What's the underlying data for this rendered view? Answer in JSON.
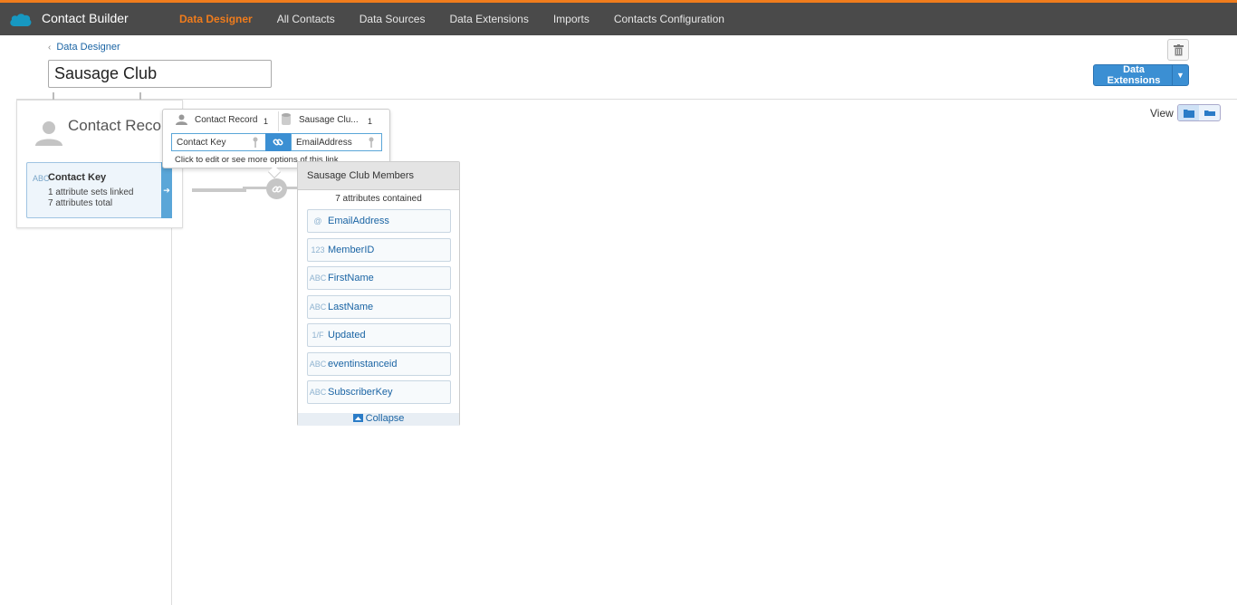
{
  "app": {
    "title": "Contact Builder"
  },
  "nav": [
    {
      "label": "Data Designer",
      "active": true
    },
    {
      "label": "All Contacts",
      "active": false
    },
    {
      "label": "Data Sources",
      "active": false
    },
    {
      "label": "Data Extensions",
      "active": false
    },
    {
      "label": "Imports",
      "active": false
    },
    {
      "label": "Contacts Configuration",
      "active": false
    }
  ],
  "breadcrumb": {
    "label": "Data Designer"
  },
  "page": {
    "title_value": "Sausage Club"
  },
  "toolbar": {
    "data_extensions_label": "Data Extensions",
    "view_label": "View"
  },
  "contact_record": {
    "title": "Contact Record",
    "card": {
      "type_icon": "ABC",
      "name": "Contact Key",
      "line1": "1 attribute sets linked",
      "line2": "7 attributes total"
    }
  },
  "link_popup": {
    "left_name": "Contact Record",
    "left_count": "1",
    "right_name": "Sausage Clu...",
    "right_count": "1",
    "left_field": "Contact Key",
    "right_field": "EmailAddress",
    "hint": "Click to edit or see more options of this link."
  },
  "data_extension": {
    "title": "Sausage Club Members",
    "count": "7 attributes contained",
    "attributes": [
      {
        "icon": "@",
        "name": "EmailAddress"
      },
      {
        "icon": "123",
        "name": "MemberID"
      },
      {
        "icon": "ABC",
        "name": "FirstName"
      },
      {
        "icon": "ABC",
        "name": "LastName"
      },
      {
        "icon": "1/F",
        "name": "Updated"
      },
      {
        "icon": "ABC",
        "name": "eventinstanceid"
      },
      {
        "icon": "ABC",
        "name": "SubscriberKey"
      }
    ],
    "collapse_label": "Collapse"
  },
  "colors": {
    "accent": "#f07c1c",
    "topbar": "#4a4a4a",
    "link_blue": "#1a64a4",
    "button_blue": "#3b8fd3"
  }
}
